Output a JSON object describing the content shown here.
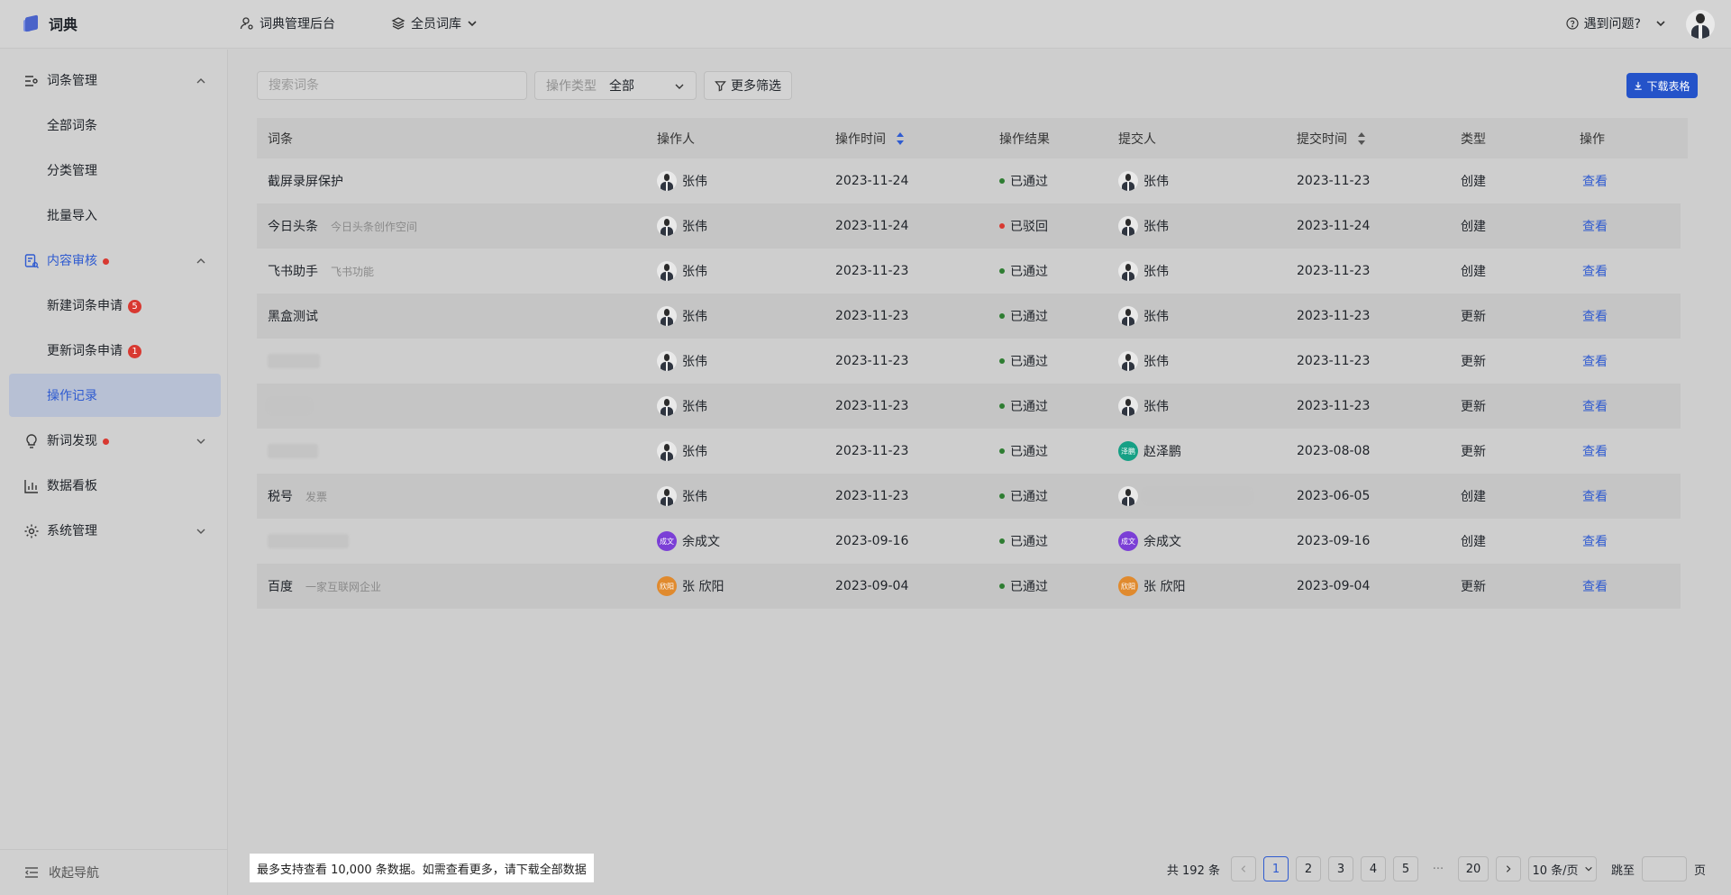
{
  "header": {
    "app_name": "词典",
    "nav": [
      {
        "label": "词典管理后台"
      },
      {
        "label": "全员词库"
      }
    ],
    "help_label": "遇到问题?"
  },
  "sidebar": {
    "groups": [
      {
        "label": "词条管理",
        "expanded": true,
        "items": [
          {
            "label": "全部词条"
          },
          {
            "label": "分类管理"
          },
          {
            "label": "批量导入"
          }
        ]
      },
      {
        "label": "内容审核",
        "expanded": true,
        "dot": true,
        "items": [
          {
            "label": "新建词条申请",
            "badge": "5"
          },
          {
            "label": "更新词条申请",
            "badge": "1"
          },
          {
            "label": "操作记录",
            "active": true
          }
        ]
      },
      {
        "label": "新词发现",
        "dot": true
      },
      {
        "label": "数据看板"
      },
      {
        "label": "系统管理"
      }
    ],
    "collapse_label": "收起导航"
  },
  "toolbar": {
    "search_placeholder": "搜索词条",
    "op_type_label": "操作类型",
    "op_type_value": "全部",
    "more_filters": "更多筛选",
    "download": "下载表格"
  },
  "table": {
    "columns": [
      "词条",
      "操作人",
      "操作时间",
      "操作结果",
      "提交人",
      "提交时间",
      "类型",
      "操作"
    ],
    "rows": [
      {
        "term": "截屏录屏保护",
        "desc": "",
        "operator": "张伟",
        "op_time": "2023-11-24",
        "result": "已通过",
        "submitter": "张伟",
        "submit_time": "2023-11-23",
        "type": "创建",
        "action": "查看"
      },
      {
        "term": "今日头条",
        "desc": "今日头条创作空间",
        "operator": "张伟",
        "op_time": "2023-11-24",
        "result": "已驳回",
        "submitter": "张伟",
        "submit_time": "2023-11-24",
        "type": "创建",
        "action": "查看"
      },
      {
        "term": "飞书助手",
        "desc": "飞书功能",
        "operator": "张伟",
        "op_time": "2023-11-23",
        "result": "已通过",
        "submitter": "张伟",
        "submit_time": "2023-11-23",
        "type": "创建",
        "action": "查看"
      },
      {
        "term": "黑盒测试",
        "desc": "",
        "operator": "张伟",
        "op_time": "2023-11-23",
        "result": "已通过",
        "submitter": "张伟",
        "submit_time": "2023-11-23",
        "type": "更新",
        "action": "查看"
      },
      {
        "term": "",
        "desc": "",
        "operator": "张伟",
        "op_time": "2023-11-23",
        "result": "已通过",
        "submitter": "张伟",
        "submit_time": "2023-11-23",
        "type": "更新",
        "action": "查看"
      },
      {
        "term": "",
        "desc": "",
        "operator": "张伟",
        "op_time": "2023-11-23",
        "result": "已通过",
        "submitter": "张伟",
        "submit_time": "2023-11-23",
        "type": "更新",
        "action": "查看"
      },
      {
        "term": "",
        "desc": "",
        "operator": "张伟",
        "op_time": "2023-11-23",
        "result": "已通过",
        "submitter": "赵泽鹏",
        "submitter_tag": "泽鹏",
        "submit_time": "2023-08-08",
        "type": "更新",
        "action": "查看"
      },
      {
        "term": "税号",
        "desc": "发票",
        "operator": "张伟",
        "op_time": "2023-11-23",
        "result": "已通过",
        "submitter": "",
        "submit_time": "2023-06-05",
        "type": "创建",
        "action": "查看"
      },
      {
        "term": "",
        "desc": "",
        "operator": "余成文",
        "operator_tag": "成文",
        "op_time": "2023-09-16",
        "result": "已通过",
        "submitter": "余成文",
        "submitter_tag": "成文",
        "submit_time": "2023-09-16",
        "type": "创建",
        "action": "查看"
      },
      {
        "term": "百度",
        "desc": "一家互联网企业",
        "operator": "张 欣阳",
        "operator_tag": "欣阳",
        "op_time": "2023-09-04",
        "result": "已通过",
        "submitter": "张 欣阳",
        "submitter_tag": "欣阳",
        "submit_time": "2023-09-04",
        "type": "更新",
        "action": "查看"
      }
    ]
  },
  "footer": {
    "note": "最多支持查看 10,000 条数据。如需查看更多，请下载全部数据",
    "total": "共 192 条",
    "pages": [
      "1",
      "2",
      "3",
      "4",
      "5"
    ],
    "ellipsis": "···",
    "last_page": "20",
    "current_page": "1",
    "page_size": "10 条/页",
    "jump_label": "跳至",
    "page_unit": "页"
  },
  "colors": {
    "accent": "#2f5bd0",
    "approved": "#2e7d32",
    "rejected": "#d83931",
    "tag_green": "#16a085",
    "tag_purple": "#7b3fd6",
    "tag_orange": "#e08a2e"
  }
}
